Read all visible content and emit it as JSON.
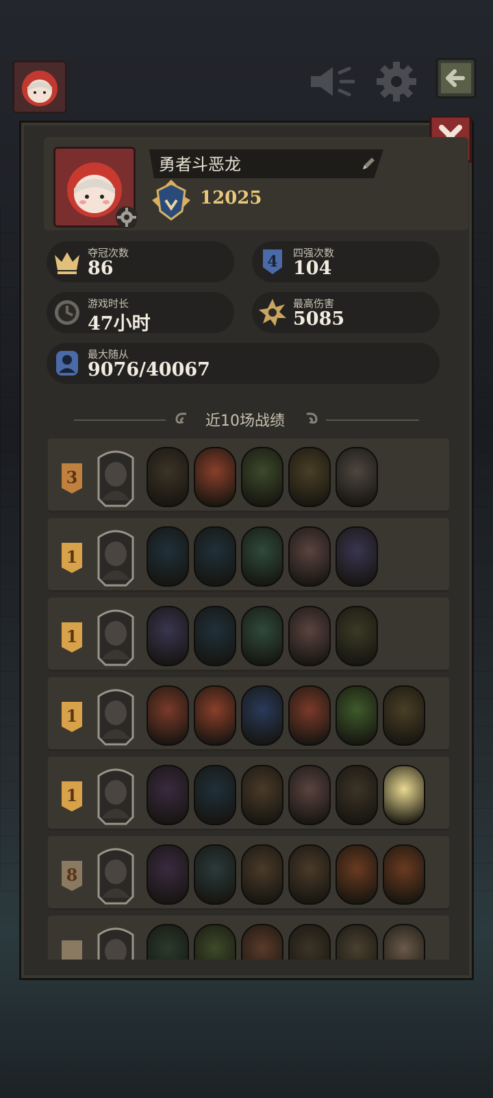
{
  "player": {
    "name": "勇者斗恶龙",
    "score": "12025"
  },
  "stats": {
    "championships": {
      "label": "夺冠次数",
      "value": "86"
    },
    "top4": {
      "label": "四强次数",
      "value": "104"
    },
    "playtime": {
      "label": "游戏时长",
      "value": "47小时"
    },
    "max_damage": {
      "label": "最高伤害",
      "value": "5085"
    },
    "max_followers": {
      "label": "最大随从",
      "value": "9076/40067"
    }
  },
  "recent": {
    "title": "近10场战绩",
    "matches": [
      {
        "rank": "3",
        "badge": "#c0813f",
        "units": [
          "#3c3326",
          "#8a3f2a",
          "#3b4a2a",
          "#4a3f26",
          "#4e4640"
        ]
      },
      {
        "rank": "1",
        "badge": "#d8a24a",
        "units": [
          "#20303a",
          "#20303a",
          "#2f4a3a",
          "#5a4340",
          "#3a3550"
        ]
      },
      {
        "rank": "1",
        "badge": "#d8a24a",
        "units": [
          "#3a3550",
          "#20303a",
          "#2f4a3a",
          "#5a4340",
          "#3b3a26"
        ]
      },
      {
        "rank": "1",
        "badge": "#d8a24a",
        "units": [
          "#7a3a2a",
          "#8a3f2a",
          "#2a3a5a",
          "#7a3a2a",
          "#3e5a2a",
          "#4a3f26"
        ]
      },
      {
        "rank": "1",
        "badge": "#d8a24a",
        "units": [
          "#3a2a40",
          "#20303a",
          "#4a3a2a",
          "#5a4340",
          "#3c3326",
          "#e8d890"
        ]
      },
      {
        "rank": "8",
        "badge": "#8a7a62",
        "units": [
          "#3a2a40",
          "#2a3a3a",
          "#4a3a2a",
          "#4a3a2a",
          "#6a3a20",
          "#6a3a20"
        ]
      },
      {
        "rank": "",
        "badge": "#8a7a62",
        "units": [
          "#2a3a2a",
          "#3e4a2a",
          "#5a3a2a",
          "#3c3326",
          "#4a4030",
          "#6a5a4a"
        ]
      }
    ]
  },
  "colors": {
    "accent_gold": "#e8c87a",
    "panel": "#2e2c28",
    "close_banner": "#8b2d2d"
  },
  "icons": [
    "speaker-icon",
    "gear-icon",
    "back-icon",
    "close-icon",
    "pencil-icon",
    "rank-crest-icon",
    "crown-icon",
    "shield-4-icon",
    "clock-icon",
    "burst-icon",
    "follower-icon"
  ]
}
